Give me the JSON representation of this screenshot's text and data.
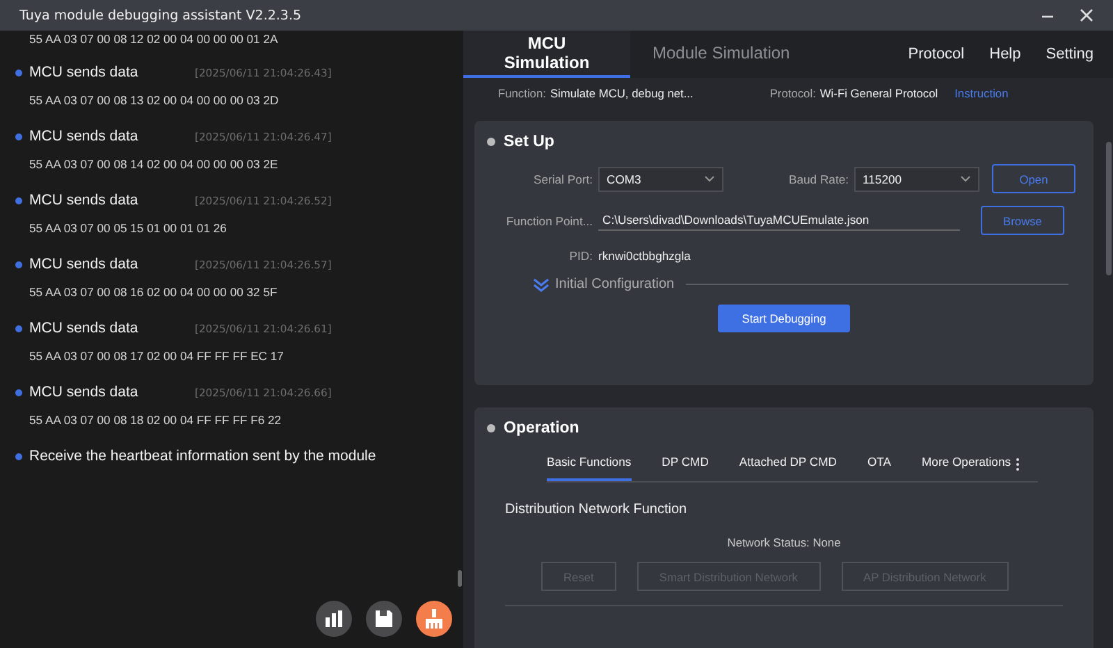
{
  "window": {
    "title": "Tuya module debugging assistant V2.2.3.5"
  },
  "log": {
    "entries": [
      {
        "kind": "data",
        "text": "55 AA 03 07 00 08 12 02 00 04 00 00 00 01 2A"
      },
      {
        "kind": "message",
        "title": "MCU sends data",
        "time": "[2025/06/11 21:04:26.43]",
        "text": "55 AA 03 07 00 08 13 02 00 04 00 00 00 03 2D"
      },
      {
        "kind": "message",
        "title": "MCU sends data",
        "time": "[2025/06/11 21:04:26.47]",
        "text": "55 AA 03 07 00 08 14 02 00 04 00 00 00 03 2E"
      },
      {
        "kind": "message",
        "title": "MCU sends data",
        "time": "[2025/06/11 21:04:26.52]",
        "text": "55 AA 03 07 00 05 15 01 00 01 01 26"
      },
      {
        "kind": "message",
        "title": "MCU sends data",
        "time": "[2025/06/11 21:04:26.57]",
        "text": "55 AA 03 07 00 08 16 02 00 04 00 00 00 32 5F"
      },
      {
        "kind": "message",
        "title": "MCU sends data",
        "time": "[2025/06/11 21:04:26.61]",
        "text": "55 AA 03 07 00 08 17 02 00 04 FF FF FF EC 17"
      },
      {
        "kind": "message",
        "title": "MCU sends data",
        "time": "[2025/06/11 21:04:26.66]",
        "text": "55 AA 03 07 00 08 18 02 00 04 FF FF FF F6 22"
      },
      {
        "kind": "message",
        "title": "Receive the heartbeat information sent by the module"
      }
    ]
  },
  "tabs": [
    {
      "label": "MCU Simulation",
      "selected": true
    },
    {
      "label": "Module Simulation",
      "selected": false
    }
  ],
  "menu": [
    "Protocol",
    "Help",
    "Setting"
  ],
  "info": {
    "function_label": "Function:",
    "function_value": "Simulate MCU, debug net...",
    "protocol_label": "Protocol:",
    "protocol_value": "Wi-Fi General Protocol",
    "link": "Instruction"
  },
  "setup": {
    "title": "Set Up",
    "serial_port_label": "Serial Port:",
    "serial_port": "COM3",
    "baud_rate_label": "Baud Rate:",
    "baud_rate": "115200",
    "open_button": "Open",
    "function_point_label": "Function Point...",
    "function_point": "C:\\Users\\divad\\Downloads\\TuyaMCUEmulate.json",
    "browse_button": "Browse",
    "pid_label": "PID:",
    "pid": "rknwi0ctbbghzgla",
    "initial_configuration": "Initial Configuration",
    "start_button": "Start Debugging"
  },
  "operation": {
    "title": "Operation",
    "tabs": [
      {
        "label": "Basic Functions",
        "selected": true
      },
      {
        "label": "DP CMD",
        "selected": false
      },
      {
        "label": "Attached DP CMD",
        "selected": false
      },
      {
        "label": "OTA",
        "selected": false
      },
      {
        "label": "More Operations",
        "selected": false
      }
    ],
    "section_title": "Distribution Network Function",
    "network_status": "Network Status: None",
    "buttons": [
      {
        "label": "Reset",
        "disabled": true
      },
      {
        "label": "Smart Distribution Network",
        "disabled": true
      },
      {
        "label": "AP Distribution Network",
        "disabled": true
      }
    ]
  }
}
